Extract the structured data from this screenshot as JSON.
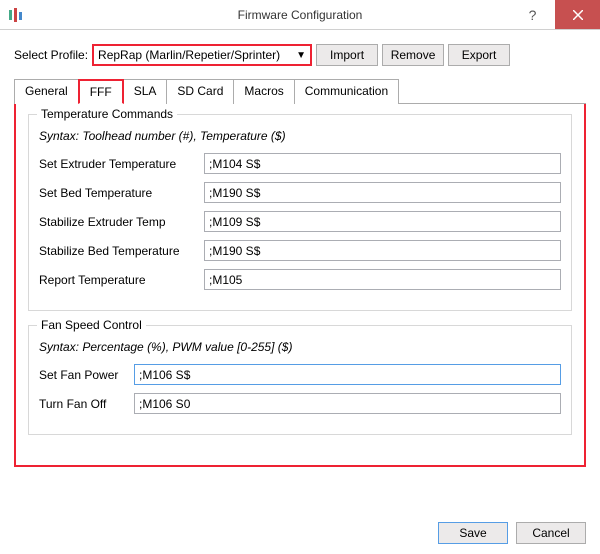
{
  "window": {
    "title": "Firmware Configuration"
  },
  "profile": {
    "label": "Select Profile:",
    "selected": "RepRap (Marlin/Repetier/Sprinter)",
    "import_btn": "Import",
    "remove_btn": "Remove",
    "export_btn": "Export"
  },
  "tabs": {
    "general": "General",
    "fff": "FFF",
    "sla": "SLA",
    "sdcard": "SD Card",
    "macros": "Macros",
    "comm": "Communication"
  },
  "temp_group": {
    "title": "Temperature Commands",
    "syntax": "Syntax: Toolhead number (#), Temperature ($)",
    "set_extruder_label": "Set Extruder Temperature",
    "set_extruder_value": ";M104 S$",
    "set_bed_label": "Set Bed Temperature",
    "set_bed_value": ";M190 S$",
    "stab_extruder_label": "Stabilize Extruder Temp",
    "stab_extruder_value": ";M109 S$",
    "stab_bed_label": "Stabilize Bed Temperature",
    "stab_bed_value": ";M190 S$",
    "report_label": "Report Temperature",
    "report_value": ";M105"
  },
  "fan_group": {
    "title": "Fan Speed Control",
    "syntax": "Syntax: Percentage (%), PWM value [0-255] ($)",
    "set_power_label": "Set Fan Power",
    "set_power_value": ";M106 S$",
    "turn_off_label": "Turn Fan Off",
    "turn_off_value": ";M106 S0"
  },
  "footer": {
    "save": "Save",
    "cancel": "Cancel"
  }
}
